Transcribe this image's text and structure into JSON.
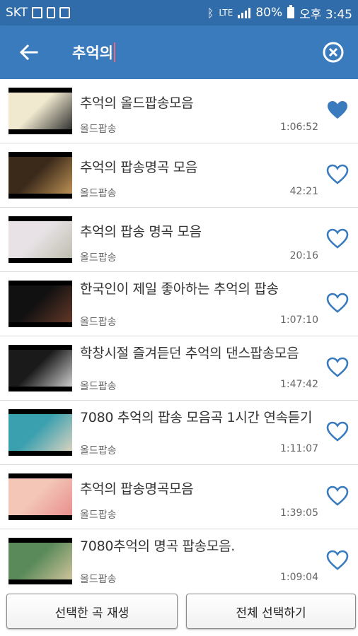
{
  "status_bar": {
    "carrier": "SKT",
    "network": "LTE",
    "battery": "80%",
    "time": "오후 3:45"
  },
  "toolbar": {
    "search_text": "추억의",
    "back_icon": "arrow-left-icon",
    "clear_icon": "clear-circle-icon"
  },
  "colors": {
    "primary": "#3a7bbd",
    "status_bar": "#2f6ca9",
    "heart": "#3a7bbd"
  },
  "songs": [
    {
      "title": "추억의 올드팝송모음",
      "channel": "올드팝송",
      "duration": "1:06:52",
      "favorite": true
    },
    {
      "title": "추억의 팝송명곡 모음",
      "channel": "올드팝송",
      "duration": "42:21",
      "favorite": false
    },
    {
      "title": "추억의 팝송 명곡 모음",
      "channel": "올드팝송",
      "duration": "20:16",
      "favorite": false
    },
    {
      "title": "한국인이 제일 좋아하는 추억의 팝송",
      "channel": "올드팝송",
      "duration": "1:07:10",
      "favorite": false
    },
    {
      "title": "학창시절 즐겨듣던 추억의 댄스팝송모음",
      "channel": "올드팝송",
      "duration": "1:47:42",
      "favorite": false
    },
    {
      "title": "7080 추억의 팝송 모음곡 1시간 연속듣기",
      "channel": "올드팝송",
      "duration": "1:11:07",
      "favorite": false
    },
    {
      "title": "추억의 팝송명곡모음",
      "channel": "올드팝송",
      "duration": "1:39:05",
      "favorite": false
    },
    {
      "title": "7080추억의  명곡 팝송모음.",
      "channel": "올드팝송",
      "duration": "1:09:04",
      "favorite": false
    }
  ],
  "buttons": {
    "play_selected": "선택한 곡 재생",
    "select_all": "전체 선택하기"
  }
}
